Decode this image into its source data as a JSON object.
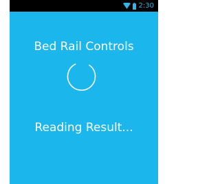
{
  "status_bar": {
    "time": "2:30",
    "icons": [
      "wifi-icon",
      "battery-icon"
    ],
    "time_color": "#33b5e5"
  },
  "screen": {
    "title": "Bed Rail Controls",
    "message": "Reading Result...",
    "background_color": "#1ab6ec",
    "spinner": "loading-spinner"
  }
}
